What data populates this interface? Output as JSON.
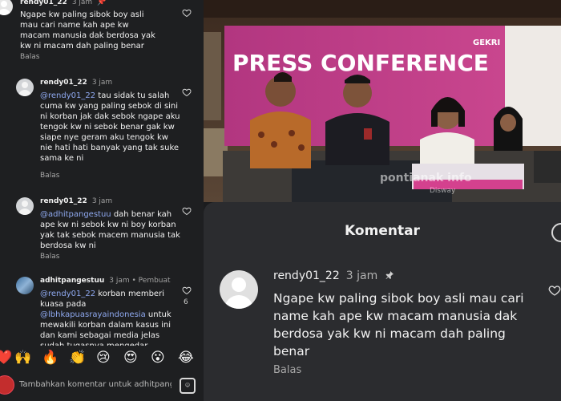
{
  "left_panel": {
    "comments": [
      {
        "username": "rendy01_22",
        "time": "3 jam",
        "pinned": true,
        "text": "Ngape kw paling sibok boy asli mau cari name kah ape kw macam manusia dak berdosa yak kw ni macam dah paling benar",
        "reply_label": "Balas"
      },
      {
        "username": "rendy01_22",
        "time": "3 jam",
        "mention": "@rendy01_22",
        "text": " tau sidak tu salah cuma kw yang paling sebok di sini ni korban jak dak sebok ngape aku tengok kw ni sebok benar gak kw siape nye geram aku tengok kw nie hati hati banyak yang tak suke sama ke ni",
        "reply_label": "Balas"
      },
      {
        "username": "rendy01_22",
        "time": "3 jam",
        "mention": "@adhitpangestuu",
        "text": " dah benar kah ape kw ni sebok kw ni boy korban yak tak sebok macem manusia tak berdosa kw ni",
        "reply_label": "Balas"
      },
      {
        "username": "adhitpangestuu",
        "time": "3 jam",
        "author_label": "• Pembuat",
        "mention": "@rendy01_22",
        "text_1": " korban memberi kuasa pada ",
        "mention_2": "@lbhkapuasrayaindonesia",
        "text_2": " untuk mewakili korban dalam kasus ini dan kami sebagai media jelas sudah tugasnya mengedar",
        "like_count": "6"
      }
    ],
    "emojis": [
      "❤️",
      "🙌",
      "🔥",
      "👏",
      "😢",
      "😍",
      "😮",
      "😂"
    ],
    "compose_placeholder": "Tambahkan komentar untuk adhitpang"
  },
  "photo": {
    "banner_text": "PRESS CONFERENCE",
    "watermark": "pontianak info",
    "watermark_sub": "Disway"
  },
  "right_panel": {
    "title": "Komentar",
    "comment": {
      "username": "rendy01_22",
      "time": "3 jam",
      "text": "Ngape kw paling sibok boy asli mau cari name kah ape kw macam manusia dak berdosa yak kw ni macam dah paling benar",
      "reply_label": "Balas"
    }
  },
  "colors": {
    "background": "#1e1f21",
    "mention": "#8fa9f0",
    "banner": "#c23a86",
    "sheet": "#2b2c2f"
  }
}
